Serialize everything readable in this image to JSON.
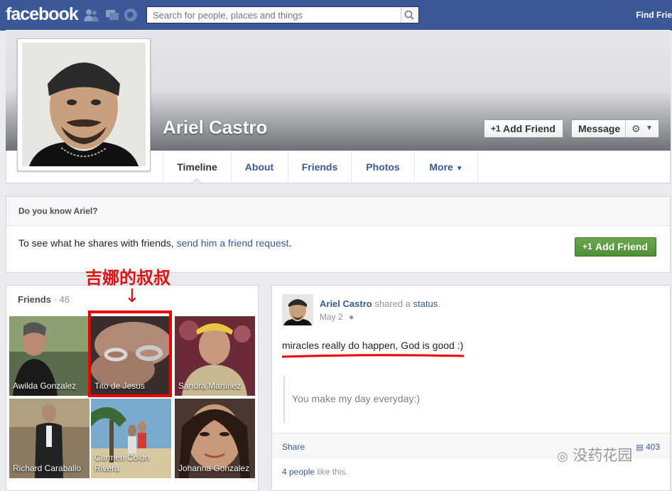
{
  "topbar": {
    "logo": "facebook",
    "search_placeholder": "Search for people, places and things",
    "find_friends": "Find Frie",
    "jewels": [
      "friend-requests-icon",
      "messages-icon",
      "notifications-icon"
    ]
  },
  "profile": {
    "name": "Ariel Castro",
    "add_friend_label": "Add Friend",
    "message_label": "Message",
    "tabs": [
      "Timeline",
      "About",
      "Friends",
      "Photos",
      "More"
    ]
  },
  "know_box": {
    "title": "Do you know Ariel?",
    "text_before": "To see what he shares with friends, ",
    "link": "send him a friend request",
    "text_after": ".",
    "button": "Add Friend"
  },
  "annotation": {
    "text": "吉娜的叔叔",
    "arrow": "↓"
  },
  "friends": {
    "title": "Friends",
    "separator": " · ",
    "count": "46",
    "items": [
      {
        "name": "Awilda Gonzalez",
        "color": "#5a6b4e"
      },
      {
        "name": "Tito de Jesus",
        "color": "#6a4e44"
      },
      {
        "name": "Sandra Martinez",
        "color": "#7a3540"
      },
      {
        "name": "Richard Caraballo",
        "color": "#3a3530"
      },
      {
        "name": "Carmen Colon\nRivera",
        "color": "#5b8aa8"
      },
      {
        "name": "Johanna Gonzalez",
        "color": "#5a4438"
      }
    ]
  },
  "post": {
    "author": "Ariel Castro",
    "action": " shared a ",
    "action_link": "status",
    "action_end": ".",
    "date": "May 2",
    "status": "miracles really do happen, God is good :)",
    "quote": "You make my day everyday:)",
    "share": "Share",
    "count": "403",
    "likes_link": "4 people",
    "likes_text": " like this."
  },
  "watermark": "没药花园",
  "colors": {
    "brand": "#3b5998",
    "annotation": "#e01010",
    "green_button": "#5a9b40"
  }
}
